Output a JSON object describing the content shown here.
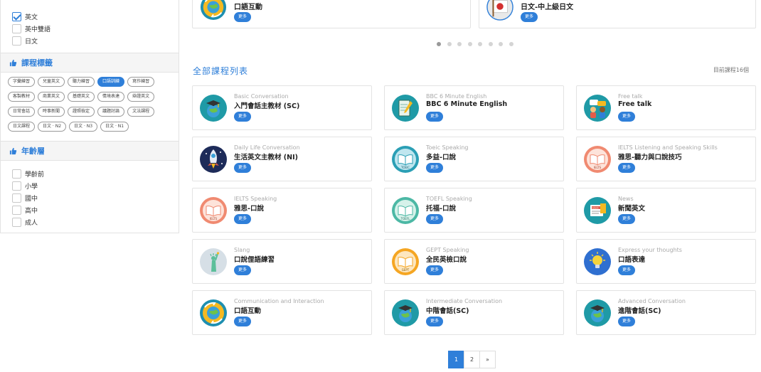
{
  "sidebar": {
    "languages": [
      {
        "label": "英文",
        "checked": true
      },
      {
        "label": "英中雙語",
        "checked": false
      },
      {
        "label": "日文",
        "checked": false
      }
    ],
    "tag_section_title": "課程標籤",
    "tags": [
      {
        "label": "字彙練習",
        "active": false
      },
      {
        "label": "兒童英文",
        "active": false
      },
      {
        "label": "聽力練習",
        "active": false
      },
      {
        "label": "口語訓練",
        "active": true
      },
      {
        "label": "寫作練習",
        "active": false
      },
      {
        "label": "客製教材",
        "active": false
      },
      {
        "label": "商業英文",
        "active": false
      },
      {
        "label": "基礎英文",
        "active": false
      },
      {
        "label": "情境表達",
        "active": false
      },
      {
        "label": "辯證英文",
        "active": false
      },
      {
        "label": "日常會話",
        "active": false
      },
      {
        "label": "時事新聞",
        "active": false
      },
      {
        "label": "證照檢定",
        "active": false
      },
      {
        "label": "議題討論",
        "active": false
      },
      {
        "label": "文法課程",
        "active": false
      },
      {
        "label": "日文課程",
        "active": false
      },
      {
        "label": "日文 · N2",
        "active": false
      },
      {
        "label": "日文 · N3",
        "active": false
      },
      {
        "label": "日文 · N1",
        "active": false
      }
    ],
    "age_section_title": "年齡層",
    "ages": [
      {
        "label": "學齡前"
      },
      {
        "label": "小學"
      },
      {
        "label": "國中"
      },
      {
        "label": "高中"
      },
      {
        "label": "成人"
      }
    ]
  },
  "carousel": {
    "cards": [
      {
        "title": "口語互動",
        "more": "更多",
        "icon": "globe-arrows-icon"
      },
      {
        "title": "日文-中上級日文",
        "more": "更多",
        "icon": "japan-flag-icon"
      }
    ],
    "dot_count": 8,
    "active_dot": 0
  },
  "list": {
    "title": "全部課程列表",
    "count_text": "目前課程16個",
    "more_label": "更多",
    "courses": [
      {
        "en": "Basic Conversation",
        "zh": "入門會話主教材 (SC)",
        "icon": "graduation-globe-icon"
      },
      {
        "en": "BBC 6 Minute English",
        "zh": "BBC 6 Minute English",
        "icon": "notebook-pen-icon"
      },
      {
        "en": "Free talk",
        "zh": "Free talk",
        "icon": "people-talk-icon"
      },
      {
        "en": "Daily Life Conversation",
        "zh": "生活英文主教材 (NI)",
        "icon": "rocket-icon"
      },
      {
        "en": "Toeic Speaking",
        "zh": "多益-口說",
        "icon": "toeic-book-icon"
      },
      {
        "en": "IELTS Listening and Speaking Skills",
        "zh": "雅思-聽力與口說技巧",
        "icon": "ielts-book-icon"
      },
      {
        "en": "IELTS Speaking",
        "zh": "雅思-口說",
        "icon": "ielts-book-icon"
      },
      {
        "en": "TOEFL Speaking",
        "zh": "托福-口說",
        "icon": "toefl-book-icon"
      },
      {
        "en": "News",
        "zh": "新聞英文",
        "icon": "news-icon"
      },
      {
        "en": "Slang",
        "zh": "口說俚語練習",
        "icon": "liberty-statue-icon"
      },
      {
        "en": "GEPT Speaking",
        "zh": "全民英檢口說",
        "icon": "gept-book-icon"
      },
      {
        "en": "Express your thoughts",
        "zh": "口語表達",
        "icon": "lightbulb-icon"
      },
      {
        "en": "Communication and Interaction",
        "zh": "口語互動",
        "icon": "globe-arrows-icon"
      },
      {
        "en": "Intermediate Conversation",
        "zh": "中階會話(SC)",
        "icon": "graduation-globe-icon"
      },
      {
        "en": "Advanced Conversation",
        "zh": "進階會話(SC)",
        "icon": "graduation-globe-icon"
      }
    ]
  },
  "pagination": {
    "pages": [
      "1",
      "2"
    ],
    "current": "1",
    "next": "»"
  },
  "colors": {
    "accent": "#2f7fd9",
    "border": "#e3e3e3"
  }
}
